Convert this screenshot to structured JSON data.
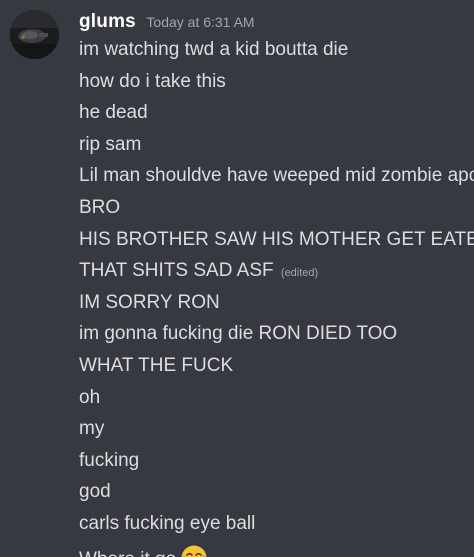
{
  "author": {
    "username": "glums",
    "timestamp": "Today at 6:31 AM"
  },
  "messages": [
    {
      "text": "im watching twd a kid boutta die"
    },
    {
      "text": "how do i take this"
    },
    {
      "text": "he dead"
    },
    {
      "text": "rip sam"
    },
    {
      "text": "Lil man shouldve have weeped mid zombie apoc"
    },
    {
      "text": "BRO"
    },
    {
      "text": "HIS BROTHER SAW HIS MOTHER GET EATEN"
    },
    {
      "text": "THAT SHITS SAD ASF",
      "edited": "(edited)"
    },
    {
      "text": "IM SORRY RON"
    },
    {
      "text": "im gonna fucking die RON DIED TOO"
    },
    {
      "text": "WHAT THE FUCK"
    },
    {
      "text": "oh"
    },
    {
      "text": "my"
    },
    {
      "text": "fucking"
    },
    {
      "text": "god"
    },
    {
      "text": "carls fucking eye ball"
    },
    {
      "text": "Where it go",
      "emoji": "face-with-tears-of-joy-emoji"
    }
  ],
  "colors": {
    "background": "#36393f",
    "username": "#ffffff",
    "message_text": "#dcddde",
    "muted": "#a3a6aa",
    "emoji_face": "#f7c23a"
  }
}
